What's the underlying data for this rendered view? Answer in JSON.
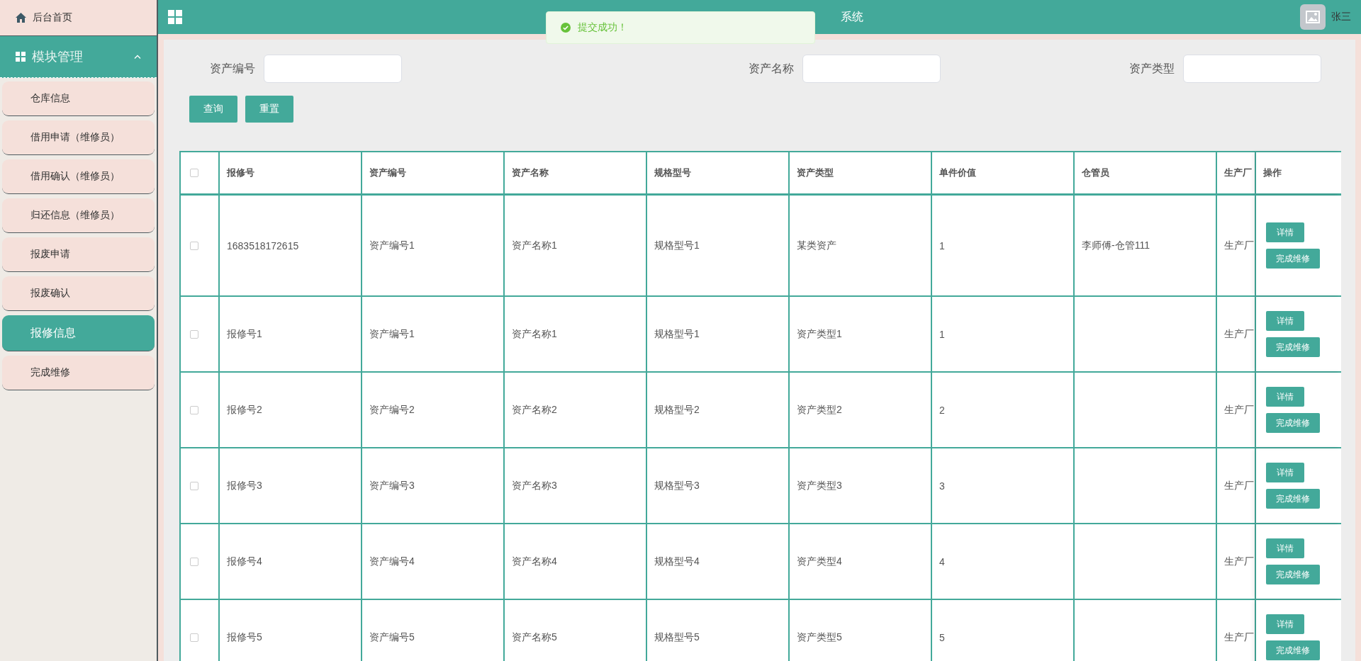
{
  "sidebar": {
    "home": {
      "label": "后台首页"
    },
    "group": {
      "label": "模块管理",
      "expanded": true
    },
    "items": [
      {
        "label": "仓库信息",
        "selected": false
      },
      {
        "label": "借用申请（维修员）",
        "selected": false
      },
      {
        "label": "借用确认（维修员）",
        "selected": false
      },
      {
        "label": "归还信息（维修员）",
        "selected": false
      },
      {
        "label": "报废申请",
        "selected": false
      },
      {
        "label": "报废确认",
        "selected": false
      },
      {
        "label": "报修信息",
        "selected": true
      },
      {
        "label": "完成维修",
        "selected": false
      }
    ]
  },
  "header": {
    "title": "系统",
    "user": "张三"
  },
  "toast": {
    "message": "提交成功！"
  },
  "search": {
    "fields": [
      {
        "label": "资产编号"
      },
      {
        "label": "资产名称"
      },
      {
        "label": "资产类型"
      }
    ],
    "buttons": [
      "查询",
      "重置"
    ]
  },
  "table": {
    "all_checked": false,
    "columns": [
      "报修号",
      "资产编号",
      "资产名称",
      "规格型号",
      "资产类型",
      "单件价值",
      "仓管员",
      "生产厂",
      "操作"
    ],
    "rows": [
      {
        "checked": false,
        "cells": [
          "1683518172615",
          "资产编号1",
          "资产名称1",
          "规格型号1",
          "某类资产",
          "1",
          "李师傅-仓管111",
          "生产厂"
        ],
        "actions": [
          "详情",
          "完成维修"
        ]
      },
      {
        "checked": false,
        "cells": [
          "报修号1",
          "资产编号1",
          "资产名称1",
          "规格型号1",
          "资产类型1",
          "1",
          null,
          "生产厂"
        ],
        "actions": [
          "详情",
          "完成维修"
        ]
      },
      {
        "checked": false,
        "cells": [
          "报修号2",
          "资产编号2",
          "资产名称2",
          "规格型号2",
          "资产类型2",
          "2",
          null,
          "生产厂"
        ],
        "actions": [
          "详情",
          "完成维修"
        ]
      },
      {
        "checked": false,
        "cells": [
          "报修号3",
          "资产编号3",
          "资产名称3",
          "规格型号3",
          "资产类型3",
          "3",
          null,
          "生产厂"
        ],
        "actions": [
          "详情",
          "完成维修"
        ]
      },
      {
        "checked": false,
        "cells": [
          "报修号4",
          "资产编号4",
          "资产名称4",
          "规格型号4",
          "资产类型4",
          "4",
          null,
          "生产厂"
        ],
        "actions": [
          "详情",
          "完成维修"
        ]
      },
      {
        "checked": false,
        "cells": [
          "报修号5",
          "资产编号5",
          "资产名称5",
          "规格型号5",
          "资产类型5",
          "5",
          null,
          "生产厂"
        ],
        "actions": [
          "详情",
          "完成维修"
        ]
      }
    ]
  }
}
